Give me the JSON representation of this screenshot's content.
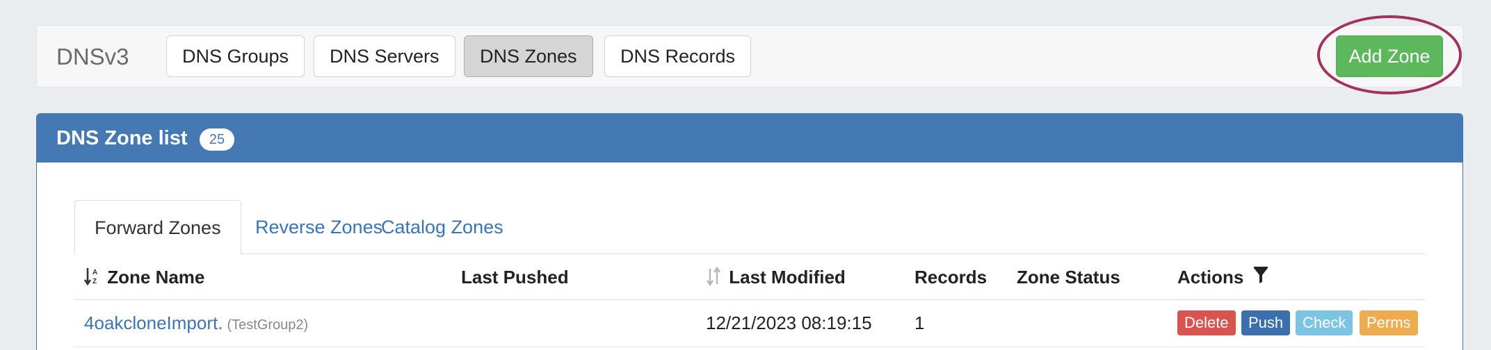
{
  "app": {
    "title": "DNSv3"
  },
  "nav": {
    "groups": "DNS Groups",
    "servers": "DNS Servers",
    "zones": "DNS Zones",
    "records": "DNS Records",
    "active": "DNS Zones"
  },
  "toolbar": {
    "add_zone": "Add Zone"
  },
  "panel": {
    "title": "DNS Zone list",
    "count": "25"
  },
  "tabs": {
    "forward": "Forward Zones",
    "reverse": "Reverse Zones",
    "catalog": "Catalog Zones",
    "active": "Forward Zones"
  },
  "table": {
    "columns": {
      "zone_name": "Zone Name",
      "last_pushed": "Last Pushed",
      "last_modified": "Last Modified",
      "records": "Records",
      "zone_status": "Zone Status",
      "actions": "Actions"
    },
    "rows": [
      {
        "zone_name": "4oakcloneImport.",
        "group": "(TestGroup2)",
        "last_pushed": "",
        "last_modified": "12/21/2023 08:19:15",
        "records": "1",
        "zone_status": "",
        "actions": {
          "delete": "Delete",
          "push": "Push",
          "check": "Check",
          "perms": "Perms"
        }
      }
    ]
  },
  "colors": {
    "panel_header": "#4579b3",
    "add_button": "#5cb85c",
    "delete": "#d9534f",
    "push": "#3b6fae",
    "check": "#7cc4e4",
    "perms": "#efac4e",
    "highlight_ring": "#a3305e",
    "link": "#3a74b3"
  },
  "icons": {
    "sort_zone_name": "sort-alpha-down-icon",
    "sort_last_modified": "sort-icon",
    "actions_filter": "filter-icon"
  }
}
